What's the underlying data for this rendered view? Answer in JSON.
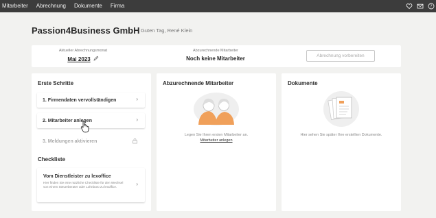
{
  "topnav": {
    "items": [
      "Mitarbeiter",
      "Abrechnung",
      "Dokumente",
      "Firma"
    ],
    "icons": [
      "heart-icon",
      "mail-icon",
      "help-icon"
    ]
  },
  "header": {
    "company": "Passion4Business GmbH",
    "greeting": "Guten Tag, René Klein"
  },
  "info": {
    "month_label": "Aktueller Abrechnungsmonat",
    "month_value": "Mai 2023",
    "employees_label": "Abzurechnende Mitarbeiter",
    "employees_value": "Noch keine Mitarbeiter",
    "prepare_button": "Abrechnung vorbereiten"
  },
  "first_steps": {
    "title": "Erste Schritte",
    "steps": [
      {
        "label": "1. Firmendaten vervollständigen"
      },
      {
        "label": "2. Mitarbeiter anlegen"
      },
      {
        "label": "3. Meldungen aktivieren"
      }
    ],
    "checklist_title": "Checkliste",
    "checklist_item_title": "Vom Dienstleister zu lexoffice",
    "checklist_item_desc": "Hier finden Sie eine nützliche Checkliste für den Wechsel von einem Steuerberater oder Lohnbüro zu lexoffice."
  },
  "employees_card": {
    "title": "Abzurechnende Mitarbeiter",
    "empty_text": "Legen Sie Ihren ersten Mitarbeiter an.",
    "empty_link": "Mitarbeiter anlegen"
  },
  "documents_card": {
    "title": "Dokumente",
    "empty_text": "Hier sehen Sie später Ihre erstellten Dokumente."
  },
  "colors": {
    "topbar": "#3c3c3c",
    "background": "#f2f2f0",
    "accent_orange": "#f0a05a"
  }
}
